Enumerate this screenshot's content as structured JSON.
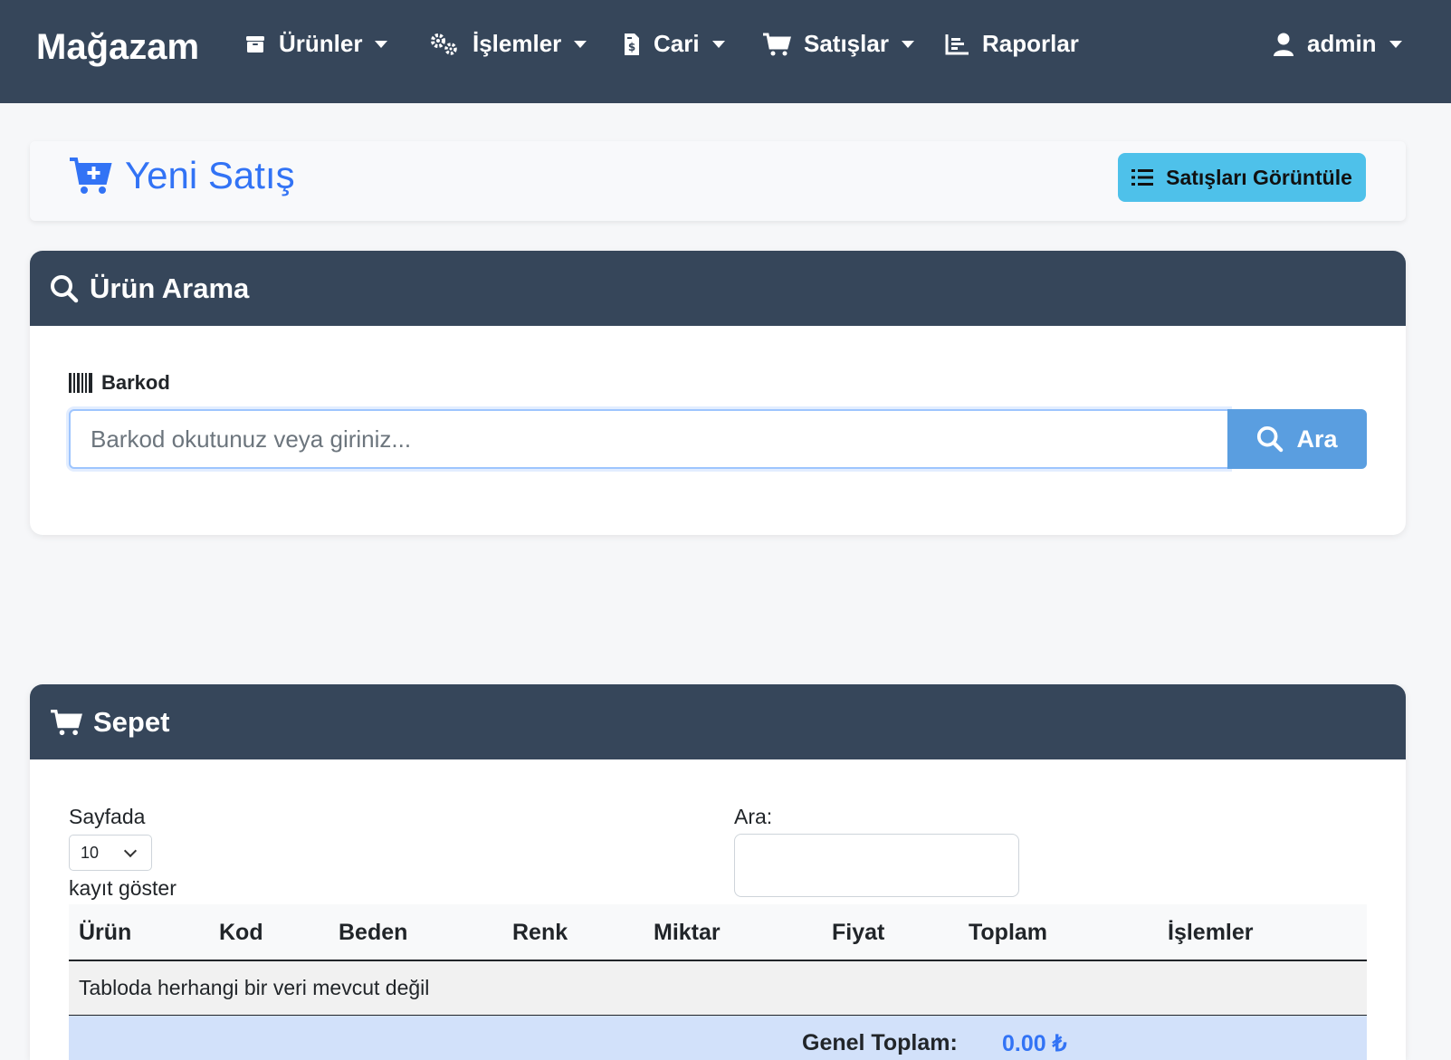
{
  "navbar": {
    "brand": "Mağazam",
    "items": [
      {
        "label": "Ürünler",
        "icon": "box-icon",
        "dropdown": true
      },
      {
        "label": "İşlemler",
        "icon": "gears-icon",
        "dropdown": true
      },
      {
        "label": "Cari",
        "icon": "invoice-dollar-icon",
        "dropdown": true
      },
      {
        "label": "Satışlar",
        "icon": "cart-icon",
        "dropdown": true
      },
      {
        "label": "Raporlar",
        "icon": "chart-line-icon",
        "dropdown": false
      }
    ],
    "user": {
      "label": "admin",
      "icon": "user-icon"
    }
  },
  "header": {
    "title": "Yeni Satış",
    "title_icon": "cart-plus-icon",
    "view_sales_label": "Satışları Görüntüle",
    "view_sales_icon": "list-icon"
  },
  "product_search": {
    "title": "Ürün Arama",
    "title_icon": "search-icon",
    "barcode_label": "Barkod",
    "barcode_icon": "barcode-icon",
    "barcode_placeholder": "Barkod okutunuz veya giriniz...",
    "search_button_label": "Ara"
  },
  "cart": {
    "title": "Sepet",
    "title_icon": "cart-icon",
    "length_prefix": "Sayfada",
    "length_value": "10",
    "length_suffix": "kayıt göster",
    "filter_label": "Ara:",
    "filter_value": "",
    "columns": [
      "Ürün",
      "Kod",
      "Beden",
      "Renk",
      "Miktar",
      "Fiyat",
      "Toplam",
      "İşlemler"
    ],
    "empty_message": "Tabloda herhangi bir veri mevcut değil",
    "total_label": "Genel Toplam:",
    "total_value": "0.00 ₺"
  },
  "colors": {
    "navbar_bg": "#36465a",
    "accent_blue": "#3273f5",
    "info_button": "#4ec1ea",
    "search_button": "#5a9ee0",
    "total_row_bg": "#d2e1fa"
  }
}
